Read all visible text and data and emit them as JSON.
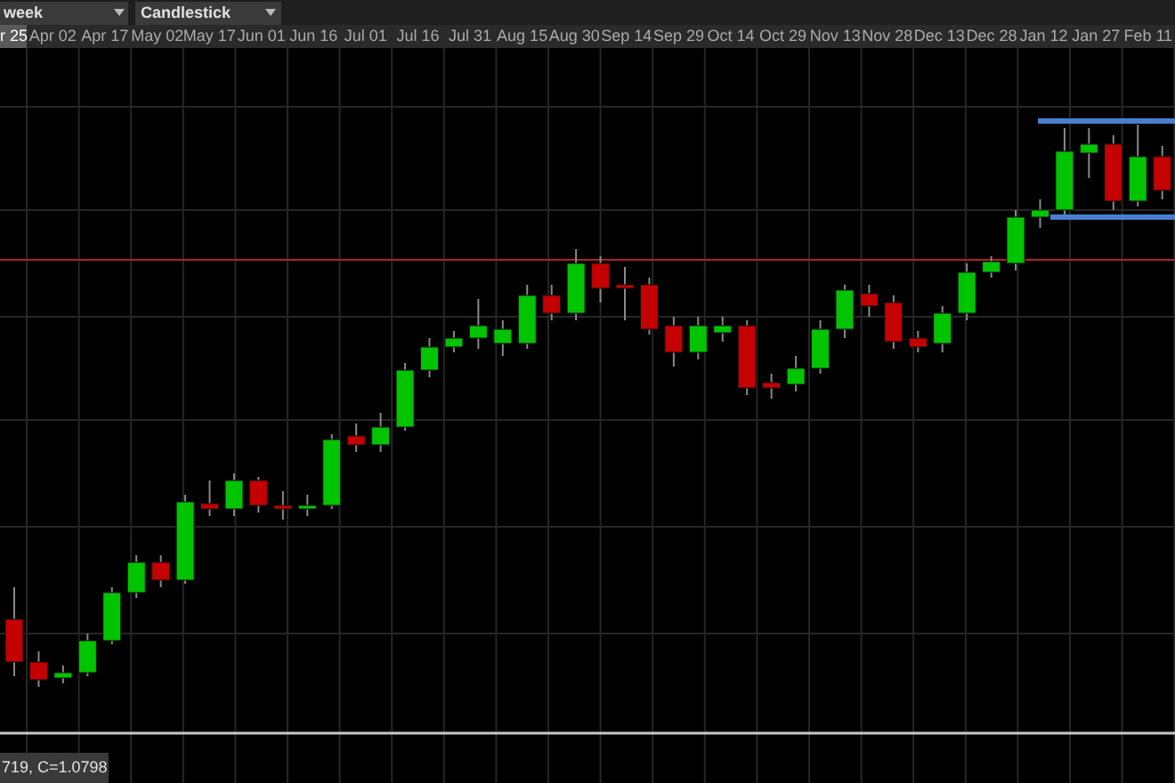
{
  "toolbar": {
    "interval": {
      "value": "week"
    },
    "chart_type": {
      "value": "Candlestick"
    }
  },
  "x_axis": {
    "labels": [
      {
        "text": "r 25",
        "highlighted": true
      },
      {
        "text": "Apr 02",
        "highlighted": false
      },
      {
        "text": "Apr 17",
        "highlighted": false
      },
      {
        "text": "May 02",
        "highlighted": false
      },
      {
        "text": "May 17",
        "highlighted": false
      },
      {
        "text": "Jun 01",
        "highlighted": false
      },
      {
        "text": "Jun 16",
        "highlighted": false
      },
      {
        "text": "Jul 01",
        "highlighted": false
      },
      {
        "text": "Jul 16",
        "highlighted": false
      },
      {
        "text": "Jul 31",
        "highlighted": false
      },
      {
        "text": "Aug 15",
        "highlighted": false
      },
      {
        "text": "Aug 30",
        "highlighted": false
      },
      {
        "text": "Sep 14",
        "highlighted": false
      },
      {
        "text": "Sep 29",
        "highlighted": false
      },
      {
        "text": "Oct 14",
        "highlighted": false
      },
      {
        "text": "Oct 29",
        "highlighted": false
      },
      {
        "text": "Nov 13",
        "highlighted": false
      },
      {
        "text": "Nov 28",
        "highlighted": false
      },
      {
        "text": "Dec 13",
        "highlighted": false
      },
      {
        "text": "Dec 28",
        "highlighted": false
      },
      {
        "text": "Jan 12",
        "highlighted": false
      },
      {
        "text": "Jan 27",
        "highlighted": false
      },
      {
        "text": "Feb 11",
        "highlighted": false
      }
    ]
  },
  "status_readout": "719, C=1.0798"
}
